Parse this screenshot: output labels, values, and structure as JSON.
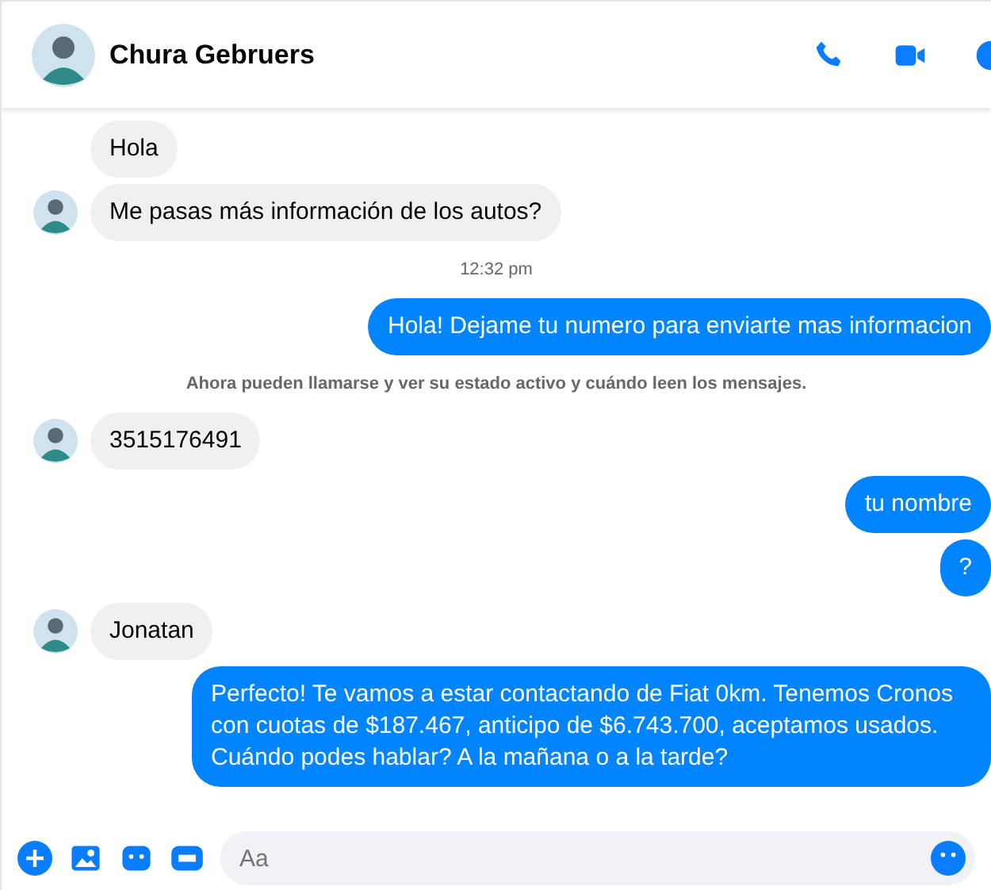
{
  "header": {
    "name": "Chura Gebruers"
  },
  "messages": [
    {
      "kind": "incoming",
      "text": "Hola",
      "avatar": false
    },
    {
      "kind": "incoming",
      "text": "Me pasas más información de los autos?",
      "avatar": true
    },
    {
      "kind": "time",
      "text": "12:32 pm"
    },
    {
      "kind": "outgoing",
      "text": "Hola! Dejame tu numero para enviarte mas informacion"
    },
    {
      "kind": "notice",
      "text": "Ahora pueden llamarse y ver su estado activo y cuándo leen los mensajes."
    },
    {
      "kind": "incoming",
      "text": "3515176491",
      "avatar": true
    },
    {
      "kind": "outgoing",
      "text": "tu nombre"
    },
    {
      "kind": "outgoing",
      "text": "?"
    },
    {
      "kind": "incoming",
      "text": "Jonatan",
      "avatar": true
    },
    {
      "kind": "outgoing",
      "text": "Perfecto! Te vamos a estar contactando de Fiat 0km. Tenemos Cronos con cuotas de $187.467, anticipo de $6.743.700, aceptamos usados. Cuándo podes hablar? A la mañana o a la tarde?"
    }
  ],
  "composer": {
    "placeholder": "Aa"
  }
}
